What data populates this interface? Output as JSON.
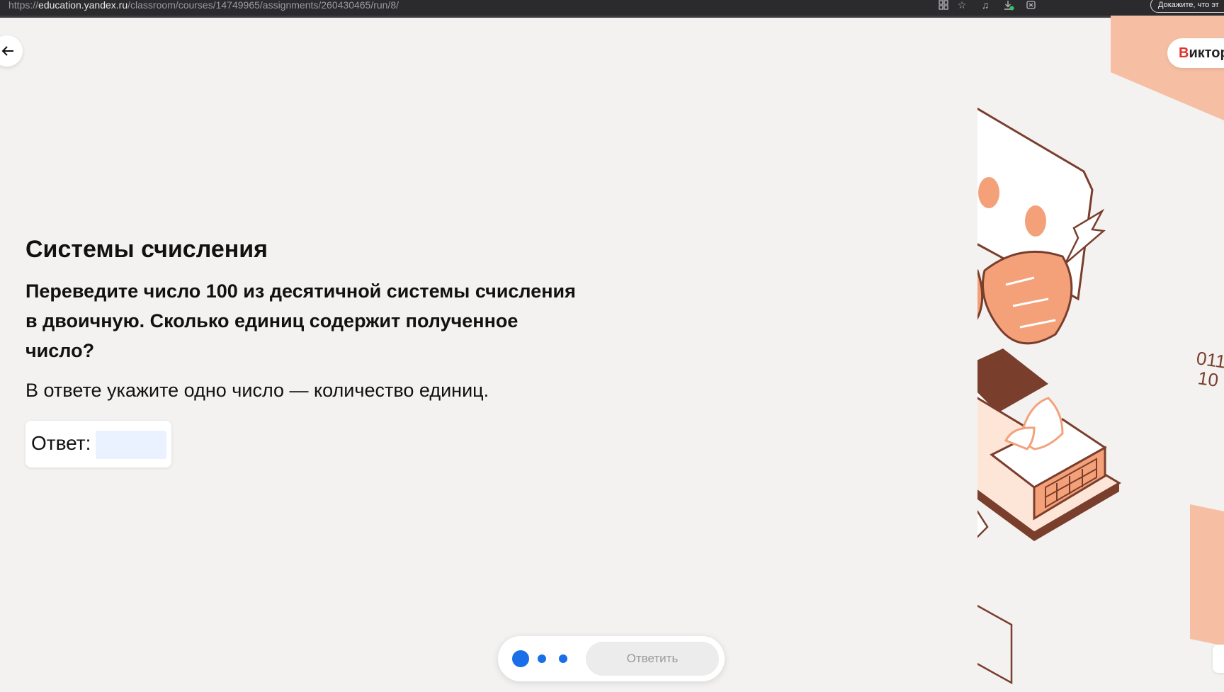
{
  "browser": {
    "url_scheme": "https://",
    "url_host": "education.yandex.ru",
    "url_path": "/classroom/courses/14749965/assignments/260430465/run/8/",
    "icons": [
      "grid-icon",
      "star-icon",
      "music-note-icon",
      "download-icon",
      "extension-icon"
    ],
    "prove_text": "Докажите, что эт"
  },
  "header": {
    "back_icon": "arrow-left-icon",
    "user_first_letter": "В",
    "user_rest": "иктор"
  },
  "task": {
    "title": "Системы счисления",
    "question": "Переведите число 100 из десятичной системы счисления в двоичную. Сколько единиц содержит полученное число?",
    "instruction": "В ответе укажите одно число — количество единиц.",
    "answer_label": "Ответ:",
    "answer_value": ""
  },
  "controls": {
    "submit_label": "Ответить",
    "steps_total": 3,
    "current_step": 1
  },
  "illustration": {
    "binary_text_top": "011",
    "binary_text_bottom": "10"
  },
  "colors": {
    "accent": "#1a6ee8",
    "peach": "#f6bfa3",
    "illustration_orange": "#f4a17a",
    "illustration_brown": "#7a3e2c",
    "background": "#f3f2f1",
    "answer_input": "#e9f2fe"
  }
}
